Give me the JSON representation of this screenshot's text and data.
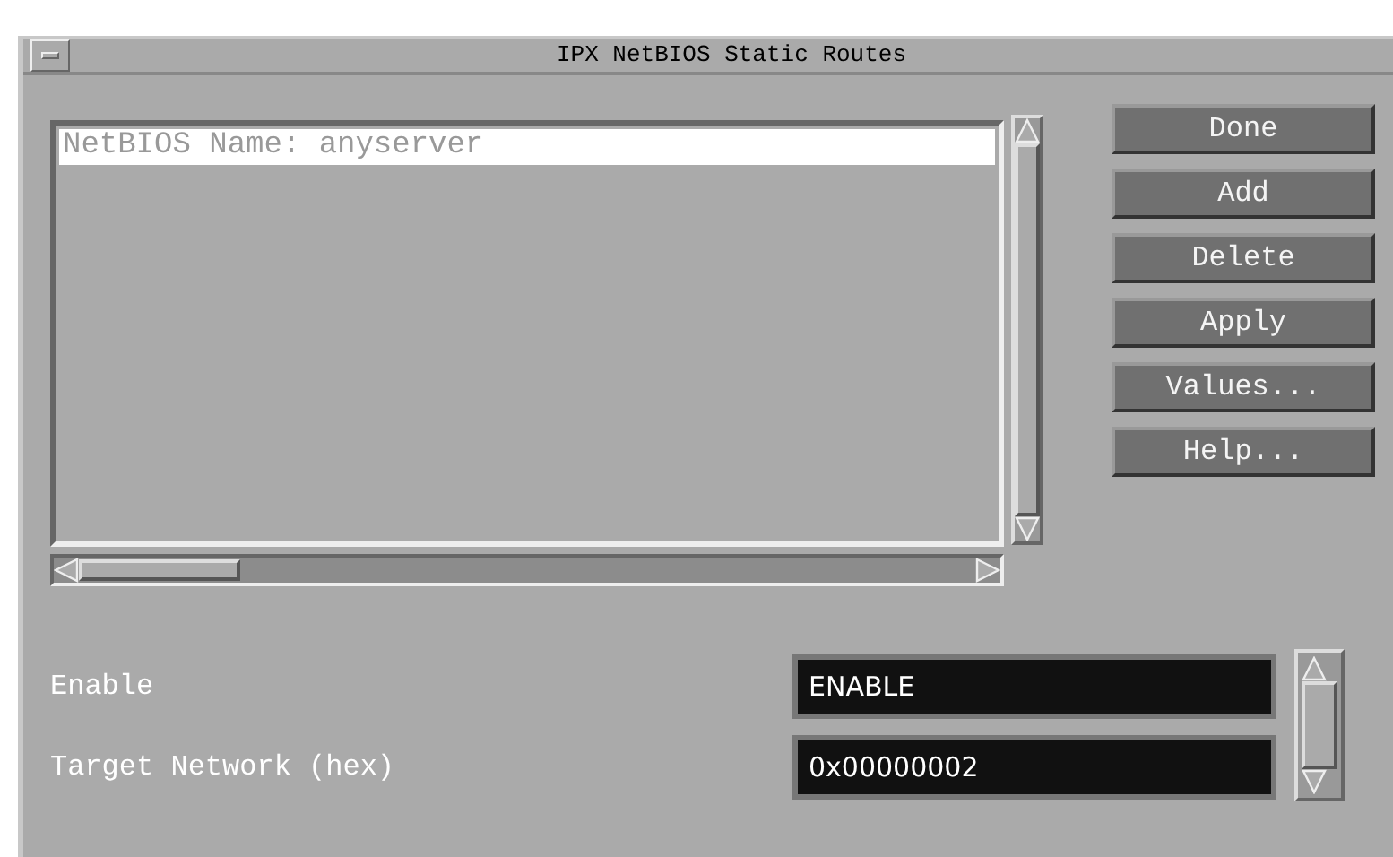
{
  "window": {
    "title": "IPX NetBIOS Static Routes"
  },
  "list": {
    "items": [
      {
        "label": "NetBIOS Name: anyserver",
        "selected": true
      }
    ]
  },
  "buttons": [
    "Done",
    "Add",
    "Delete",
    "Apply",
    "Values...",
    "Help..."
  ],
  "fields": [
    {
      "label": "Enable",
      "value": "ENABLE"
    },
    {
      "label": "Target Network (hex)",
      "value": "0x00000002"
    }
  ]
}
